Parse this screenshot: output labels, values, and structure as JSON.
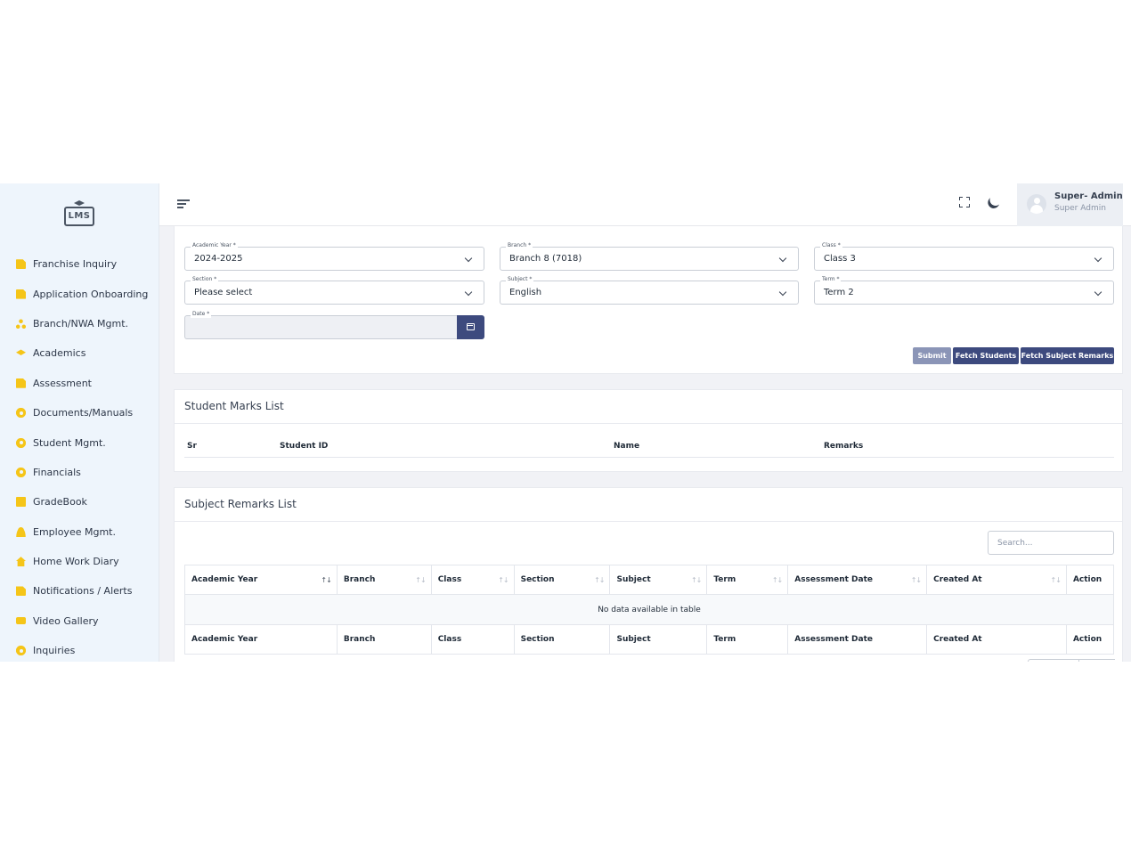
{
  "app": {
    "logo_text": "LMS"
  },
  "sidebar": {
    "items": [
      {
        "label": "Franchise Inquiry",
        "icon": "document-icon"
      },
      {
        "label": "Application Onboarding",
        "icon": "document-icon"
      },
      {
        "label": "Branch/NWA Mgmt.",
        "icon": "sitemap-icon"
      },
      {
        "label": "Academics",
        "icon": "graduation-cap-icon"
      },
      {
        "label": "Assessment",
        "icon": "document-icon"
      },
      {
        "label": "Documents/Manuals",
        "icon": "gear-icon"
      },
      {
        "label": "Student Mgmt.",
        "icon": "gear-icon"
      },
      {
        "label": "Financials",
        "icon": "gear-icon"
      },
      {
        "label": "GradeBook",
        "icon": "book-icon"
      },
      {
        "label": "Employee Mgmt.",
        "icon": "user-icon"
      },
      {
        "label": "Home Work Diary",
        "icon": "home-icon"
      },
      {
        "label": "Notifications / Alerts",
        "icon": "document-icon"
      },
      {
        "label": "Video Gallery",
        "icon": "video-icon"
      },
      {
        "label": "Inquiries",
        "icon": "gear-icon"
      }
    ]
  },
  "topbar": {
    "user_name": "Super- Admin",
    "user_role": "Super Admin"
  },
  "form": {
    "academic_year": {
      "label": "Academic Year *",
      "value": "2024-2025"
    },
    "branch": {
      "label": "Branch *",
      "value": "Branch 8 (7018)"
    },
    "class": {
      "label": "Class *",
      "value": "Class 3"
    },
    "section": {
      "label": "Section *",
      "value": "Please select"
    },
    "subject": {
      "label": "Subject *",
      "value": "English"
    },
    "term": {
      "label": "Term *",
      "value": "Term 2"
    },
    "date": {
      "label": "Date *",
      "value": ""
    },
    "buttons": {
      "submit": "Submit",
      "fetch_students": "Fetch Students",
      "fetch_remarks": "Fetch Subject Remarks"
    }
  },
  "marks_list": {
    "title": "Student Marks List",
    "headers": {
      "sr": "Sr",
      "student_id": "Student ID",
      "name": "Name",
      "remarks": "Remarks"
    }
  },
  "remarks_list": {
    "title": "Subject Remarks List",
    "search_placeholder": "Search...",
    "headers": {
      "academic_year": "Academic Year",
      "branch": "Branch",
      "class": "Class",
      "section": "Section",
      "subject": "Subject",
      "term": "Term",
      "assessment_date": "Assessment Date",
      "created_at": "Created At",
      "action": "Action"
    },
    "empty_message": "No data available in table"
  },
  "colors": {
    "primary": "#3d4a7e",
    "primary_disabled": "#8b95b7",
    "sidebar_bg": "#eef5fc",
    "icon_accent": "#f5c518"
  }
}
